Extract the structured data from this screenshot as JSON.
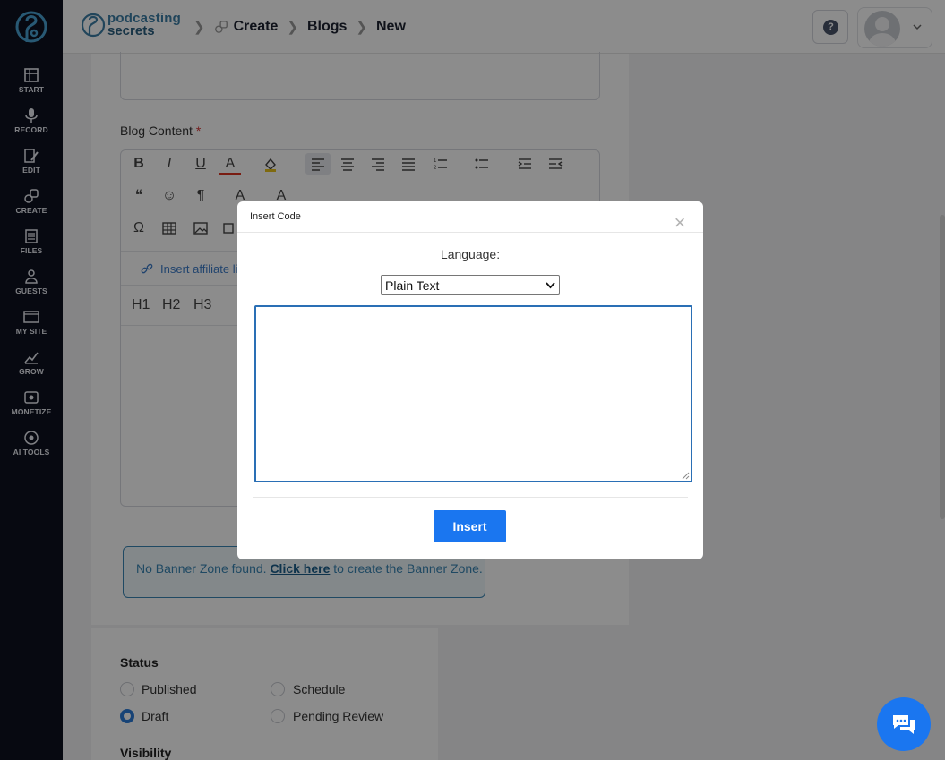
{
  "brand": {
    "line1": "podcasting",
    "line2": "secrets"
  },
  "breadcrumb": [
    "Create",
    "Blogs",
    "New"
  ],
  "header": {
    "help_icon": "question-circle-icon"
  },
  "sidebar": {
    "items": [
      {
        "label": "START",
        "icon": "start-icon"
      },
      {
        "label": "RECORD",
        "icon": "microphone-icon"
      },
      {
        "label": "EDIT",
        "icon": "edit-icon"
      },
      {
        "label": "CREATE",
        "icon": "create-icon"
      },
      {
        "label": "FILES",
        "icon": "files-icon"
      },
      {
        "label": "GUESTS",
        "icon": "guests-icon"
      },
      {
        "label": "MY SITE",
        "icon": "site-icon"
      },
      {
        "label": "GROW",
        "icon": "grow-icon"
      },
      {
        "label": "MONETIZE",
        "icon": "monetize-icon"
      },
      {
        "label": "AI TOOLS",
        "icon": "ai-tools-icon"
      }
    ]
  },
  "form": {
    "blog_content_label": "Blog Content",
    "required_mark": "*",
    "affiliate_link_text": "Insert affiliate li",
    "headings": [
      "H1",
      "H2",
      "H3"
    ],
    "banner": {
      "prefix": "No Banner Zone found.",
      "link": "Click here",
      "suffix": "to create the Banner Zone."
    }
  },
  "status": {
    "label": "Status",
    "options": [
      {
        "label": "Published",
        "checked": false
      },
      {
        "label": "Schedule",
        "checked": false
      },
      {
        "label": "Draft",
        "checked": true
      },
      {
        "label": "Pending Review",
        "checked": false
      }
    ],
    "visibility_label": "Visibility"
  },
  "modal": {
    "title": "Insert Code",
    "close_glyph": "×",
    "language_label": "Language:",
    "language_selected": "Plain Text",
    "code_value": "",
    "insert_label": "Insert"
  },
  "colors": {
    "accent": "#1a76f0",
    "sidebar_bg": "#0d1220",
    "banner_border": "#3a86b4"
  }
}
